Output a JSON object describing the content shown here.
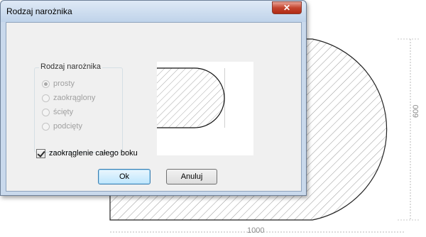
{
  "window": {
    "title": "Rodzaj narożnika",
    "close_symbol": "✕"
  },
  "group": {
    "title": "Rodzaj narożnika",
    "options": [
      {
        "label": "prosty",
        "checked": true,
        "enabled": false
      },
      {
        "label": "zaokrąglony",
        "checked": false,
        "enabled": false
      },
      {
        "label": "ścięty",
        "checked": false,
        "enabled": false
      },
      {
        "label": "podcięty",
        "checked": false,
        "enabled": false
      }
    ]
  },
  "checkbox": {
    "label": "zaokrąglenie całego boku",
    "checked": true
  },
  "buttons": {
    "ok_label": "Ok",
    "cancel_label": "Anuluj"
  },
  "drawing": {
    "width_dimension": "1000",
    "height_dimension": "600"
  }
}
